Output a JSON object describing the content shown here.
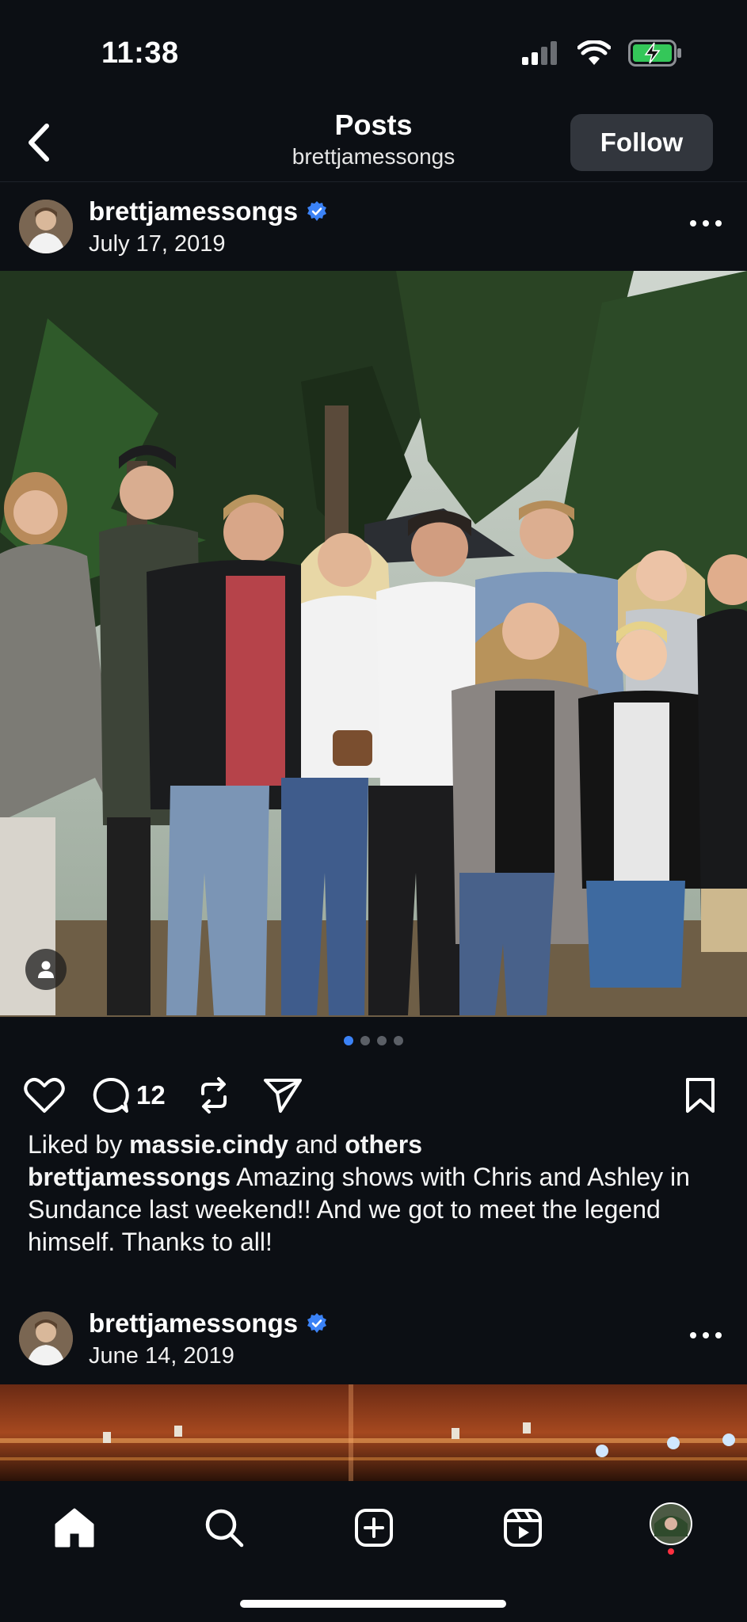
{
  "status_bar": {
    "time": "11:38"
  },
  "nav": {
    "title": "Posts",
    "subtitle": "brettjamessongs",
    "follow_label": "Follow"
  },
  "posts": [
    {
      "username": "brettjamessongs",
      "date": "July 17, 2019",
      "verified": true
    },
    {
      "username": "brettjamessongs",
      "date": "June 14, 2019",
      "verified": true
    }
  ],
  "carousel": {
    "count": 4,
    "active_index": 0
  },
  "actions": {
    "comment_count": "12"
  },
  "likes": {
    "prefix": "Liked by ",
    "user": "massie.cindy",
    "middle": " and ",
    "others": "others"
  },
  "caption": {
    "username": "brettjamessongs",
    "text": " Amazing shows with Chris and Ashley in Sundance last  weekend!! And we got to meet the legend himself. Thanks to all!"
  },
  "colors": {
    "background": "#0c0f14",
    "verified": "#3b82f6",
    "follow_button": "#32363d",
    "notification_dot": "#ff3040"
  },
  "icons": {
    "back": "chevron-left-icon",
    "verified": "verified-badge-icon",
    "more": "more-icon",
    "like": "heart-icon",
    "comment": "comment-icon",
    "repost": "repost-icon",
    "share": "send-icon",
    "save": "bookmark-icon",
    "tag": "person-tag-icon",
    "tabs": [
      "home-icon",
      "search-icon",
      "create-icon",
      "reels-icon",
      "profile-avatar-icon"
    ]
  }
}
